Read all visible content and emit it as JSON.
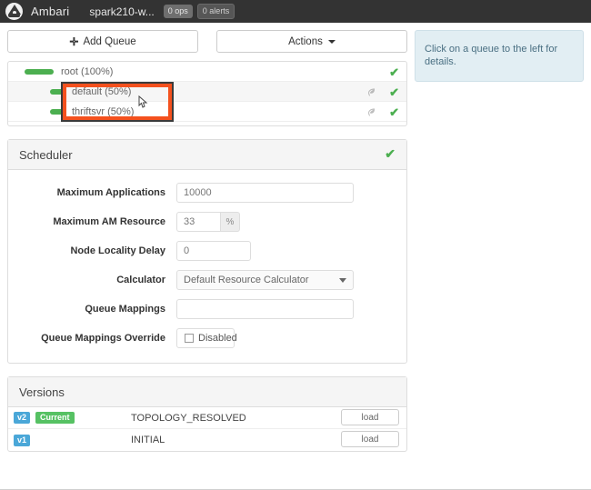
{
  "navbar": {
    "logo_name": "ambari-logo",
    "brand": "Ambari",
    "cluster": "spark210-w...",
    "ops_badge": "0 ops",
    "alerts_badge": "0 alerts"
  },
  "toolbar": {
    "add_queue_label": "Add Queue",
    "add_queue_icon": "plus-icon",
    "actions_label": "Actions",
    "actions_caret_icon": "caret-down-icon"
  },
  "queue_tree": {
    "rows": [
      {
        "label": "root (100%)",
        "level": 0,
        "has_leaf_icon": false,
        "status_icon": "check-icon"
      },
      {
        "label": "default (50%)",
        "level": 1,
        "has_leaf_icon": true,
        "status_icon": "check-icon"
      },
      {
        "label": "thriftsvr (50%)",
        "level": 1,
        "has_leaf_icon": true,
        "status_icon": "check-icon"
      }
    ],
    "highlight_target": "default (50%)",
    "highlight_color": "#f4511e"
  },
  "scheduler": {
    "title": "Scheduler",
    "status_icon": "check-icon",
    "fields": [
      {
        "label": "Maximum Applications",
        "value": "10000",
        "type": "text"
      },
      {
        "label": "Maximum AM Resource",
        "value": "33",
        "suffix": "%",
        "type": "text-addon"
      },
      {
        "label": "Node Locality Delay",
        "value": "0",
        "type": "text"
      },
      {
        "label": "Calculator",
        "value": "Default Resource Calculator",
        "type": "select"
      },
      {
        "label": "Queue Mappings",
        "value": "",
        "type": "text"
      },
      {
        "label": "Queue Mappings Override",
        "value": "Disabled",
        "type": "checkbox",
        "checked": false
      }
    ]
  },
  "versions": {
    "title": "Versions",
    "rows": [
      {
        "version": "v2",
        "current_label": "Current",
        "is_current": true,
        "name": "TOPOLOGY_RESOLVED",
        "load_label": "load"
      },
      {
        "version": "v1",
        "current_label": "",
        "is_current": false,
        "name": "INITIAL",
        "load_label": "load"
      }
    ]
  },
  "info_panel": {
    "message": "Click on a queue to the left for details."
  },
  "colors": {
    "accent_green": "#4caf50",
    "highlight_orange": "#f4511e",
    "badge_blue": "#4aa7d8",
    "badge_green": "#56c163",
    "navbar_dark": "#333333",
    "info_bg": "#e2eef3"
  }
}
